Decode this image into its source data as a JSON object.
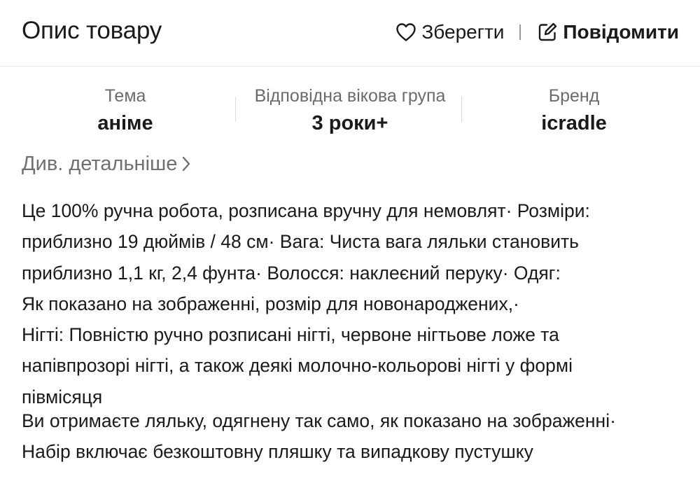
{
  "header": {
    "title": "Опис товару",
    "save_label": "Зберегти",
    "report_label": "Повідомити",
    "save_icon": "heart-outline-icon",
    "report_icon": "edit-square-icon"
  },
  "attributes": [
    {
      "label": "Тема",
      "value": "аніме"
    },
    {
      "label": "Відповідна вікова група",
      "value": "3 роки+"
    },
    {
      "label": "Бренд",
      "value": "icradle"
    }
  ],
  "details_link": {
    "label": "Див. детальніше",
    "icon": "chevron-right-icon"
  },
  "description": {
    "paragraph_1": "Це 100% ручна робота, розписана вручну для немовлят· Розміри:\nприблизно 19 дюймів / 48 см· Вага: Чиста вага ляльки становить\nприблизно 1,1 кг, 2,4 фунта· Волосся: наклеєний перуку· Одяг:\nЯк показано на зображенні, розмір для новонароджених,·\nНігті: Повністю ручно розписані нігті, червоне нігтьове ложе та\nнапівпрозорі нігті, а також деякі молочно-кольорові нігті у формі\nпівмісяця",
    "paragraph_2": "Ви отримаєте ляльку, одягнену так само, як показано на зображенні·\nНабір включає безкоштовну пляшку та випадкову пустушку"
  },
  "colors": {
    "text_primary": "#1a1a1a",
    "text_secondary": "#6b6b6b",
    "link_gray": "#707070",
    "divider": "#e6e6e6"
  }
}
